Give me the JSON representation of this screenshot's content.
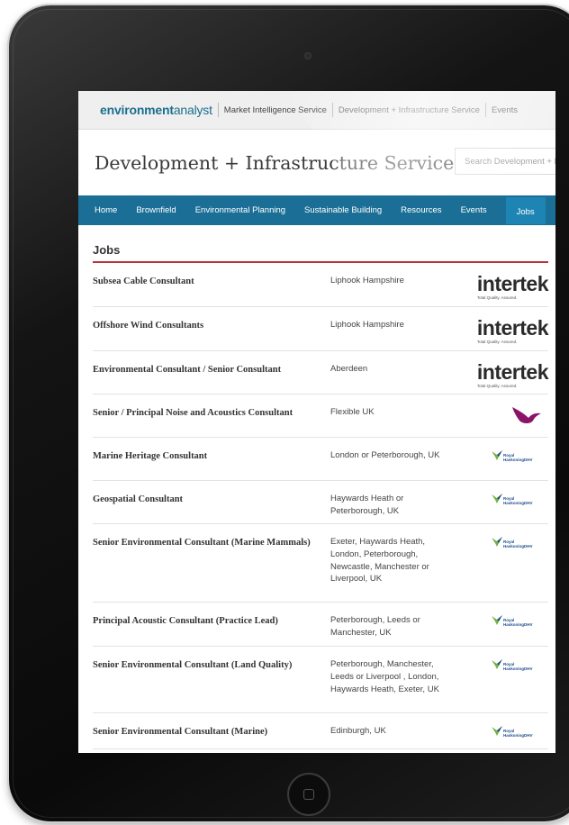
{
  "topbar": {
    "logo_bold": "environment",
    "logo_light": "analyst",
    "items": [
      "Market Intelligence Service",
      "Development + Infrastructure Service",
      "Events"
    ]
  },
  "header": {
    "title": "Development + Infrastructure Service",
    "search_placeholder": "Search Development + I"
  },
  "nav": {
    "items": [
      "Home",
      "Brownfield",
      "Environmental Planning",
      "Sustainable Building",
      "Resources",
      "Events",
      "Jobs"
    ],
    "active": "Jobs"
  },
  "jobs_section": {
    "heading": "Jobs",
    "rows": [
      {
        "title": "Subsea Cable Consultant",
        "location": "Liphook Hampshire",
        "logo": "intertek"
      },
      {
        "title": "Offshore Wind Consultants",
        "location": "Liphook Hampshire",
        "logo": "intertek"
      },
      {
        "title": "Environmental Consultant / Senior Consultant",
        "location": "Aberdeen",
        "logo": "intertek"
      },
      {
        "title": "Senior / Principal Noise and Acoustics Consultant",
        "location": "Flexible UK",
        "logo": "bird"
      },
      {
        "title": "Marine Heritage Consultant",
        "location": "London or Peterborough, UK",
        "logo": "royal-haskoningdhv"
      },
      {
        "title": "Geospatial Consultant",
        "location": "Haywards Heath or Peterborough, UK",
        "logo": "royal-haskoningdhv"
      },
      {
        "title": "Senior Environmental Consultant (Marine Mammals)",
        "location": "Exeter, Haywards Heath, London, Peterborough, Newcastle, Manchester or Liverpool, UK",
        "logo": "royal-haskoningdhv"
      },
      {
        "title": "Principal Acoustic Consultant (Practice Lead)",
        "location": "Peterborough, Leeds or Manchester, UK",
        "logo": "royal-haskoningdhv"
      },
      {
        "title": "Senior Environmental Consultant (Land Quality)",
        "location": "Peterborough, Manchester, Leeds or Liverpool , London, Haywards Heath, Exeter, UK",
        "logo": "royal-haskoningdhv"
      },
      {
        "title": "Senior Environmental Consultant (Marine)",
        "location": "Edinburgh, UK",
        "logo": "royal-haskoningdhv"
      }
    ]
  },
  "logos": {
    "intertek_word": "intertek",
    "intertek_tagline": "Total Quality. Assured.",
    "rhdhv_line1": "Royal",
    "rhdhv_line2": "HaskoningDHV"
  },
  "colors": {
    "brand_blue": "#1b6f96",
    "active_tab": "#1d84b3",
    "heading_rule": "#b8353c",
    "bird_logo": "#8a1468"
  }
}
